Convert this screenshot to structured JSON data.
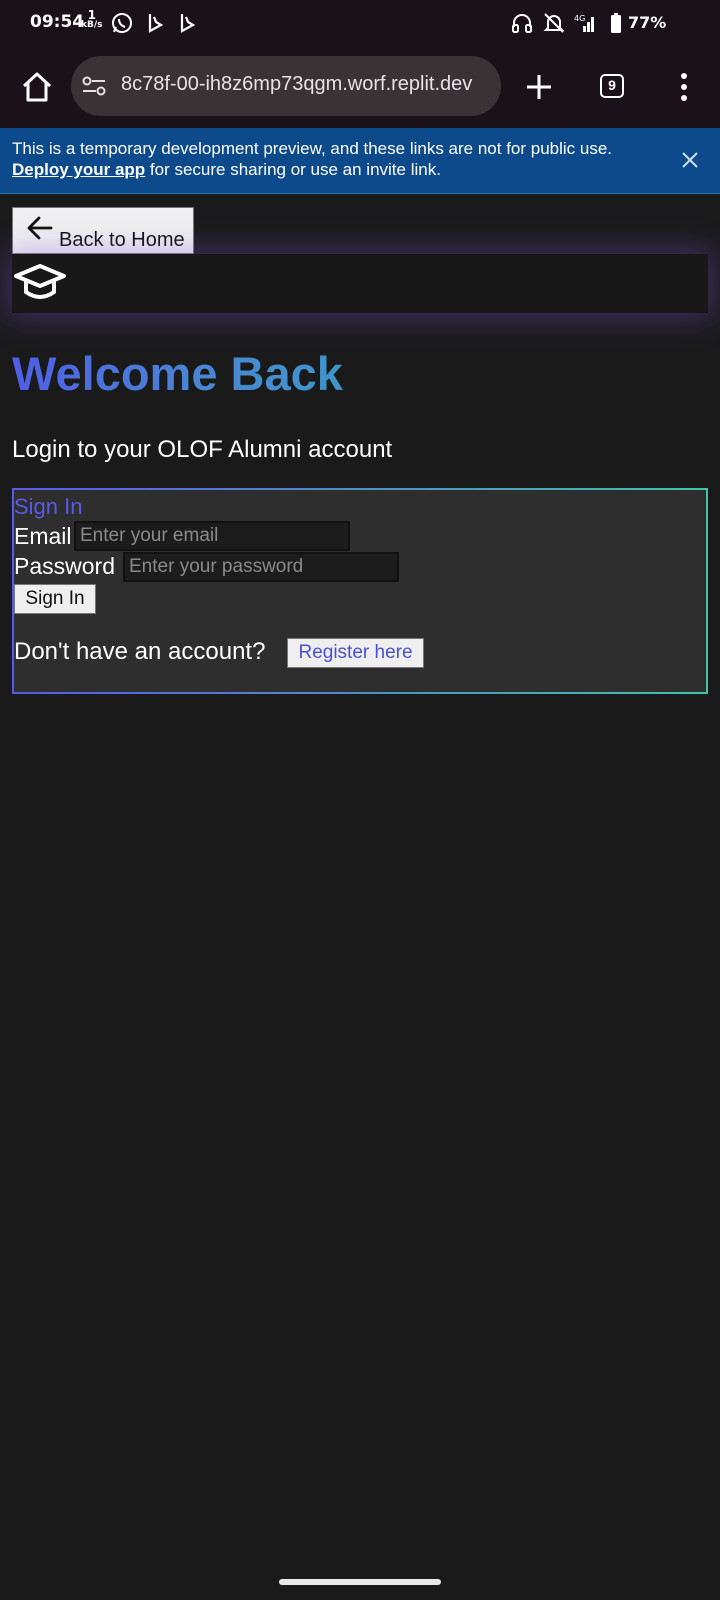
{
  "status_bar": {
    "time": "09:54",
    "net_speed_value": "1",
    "net_speed_unit": "kB/s",
    "network": "4G",
    "battery": "77%",
    "icons": [
      "whatsapp-icon",
      "bing-icon",
      "bing-icon",
      "headphones-icon",
      "bell-off-icon",
      "signal-icon",
      "battery-icon"
    ]
  },
  "browser": {
    "url": "8c78f-00-ih8z6mp73qgm.worf.replit.dev",
    "tab_count": "9"
  },
  "banner": {
    "line1": "This is a temporary development preview, and these links are not for public use.",
    "link": "Deploy your app",
    "line2_rest": " for secure sharing or use an invite link.",
    "background": "#0d4a8c"
  },
  "page": {
    "back_label": "Back to Home",
    "welcome": "Welcome Back",
    "subtitle": "Login to your OLOF Alumni account",
    "card": {
      "title": "Sign In",
      "email_label": "Email",
      "email_placeholder": "Enter your email",
      "password_label": "Password",
      "password_placeholder": "Enter your password",
      "submit_label": "Sign In",
      "no_account": "Don't have an account?",
      "register_label": "Register here"
    },
    "accent_colors": [
      "#4f5ee6",
      "#40c4a8"
    ]
  }
}
